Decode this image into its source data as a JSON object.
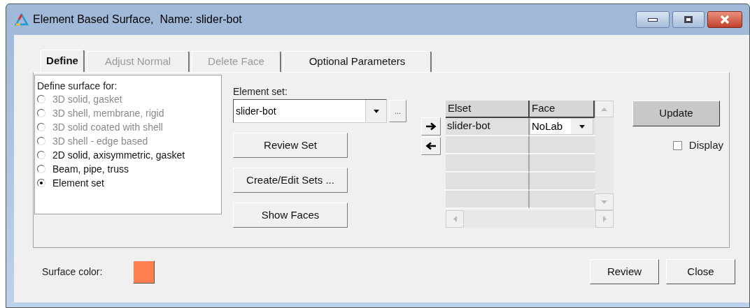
{
  "window": {
    "title": "Element Based Surface,  Name: slider-bot"
  },
  "tabs": [
    {
      "label": "Define",
      "selected": true,
      "disabled": false
    },
    {
      "label": "Adjust Normal",
      "selected": false,
      "disabled": true
    },
    {
      "label": "Delete Face",
      "selected": false,
      "disabled": true
    },
    {
      "label": "Optional Parameters",
      "selected": false,
      "disabled": false
    }
  ],
  "surface_group": {
    "label": "Define surface for:",
    "options": [
      {
        "label": "3D solid, gasket",
        "disabled": true,
        "selected": false
      },
      {
        "label": "3D shell, membrane, rigid",
        "disabled": true,
        "selected": false
      },
      {
        "label": "3D solid coated with shell",
        "disabled": true,
        "selected": false
      },
      {
        "label": "3D shell - edge based",
        "disabled": true,
        "selected": false
      },
      {
        "label": "2D solid, axisymmetric, gasket",
        "disabled": false,
        "selected": false
      },
      {
        "label": "Beam, pipe, truss",
        "disabled": false,
        "selected": false
      },
      {
        "label": "Element set",
        "disabled": false,
        "selected": true
      }
    ]
  },
  "element_set": {
    "label": "Element set:",
    "value": "slider-bot",
    "browse": "..."
  },
  "set_buttons": [
    "Review Set",
    "Create/Edit Sets ...",
    "Show Faces"
  ],
  "table": {
    "columns": [
      "Elset",
      "Face"
    ],
    "rows": [
      {
        "elset": "slider-bot",
        "face": "NoLab"
      }
    ]
  },
  "update_button": "Update",
  "display": {
    "label": "Display",
    "checked": false
  },
  "surface_color": {
    "label": "Surface color:",
    "color": "#ff7f50"
  },
  "footer_buttons": [
    "Review",
    "Close"
  ]
}
